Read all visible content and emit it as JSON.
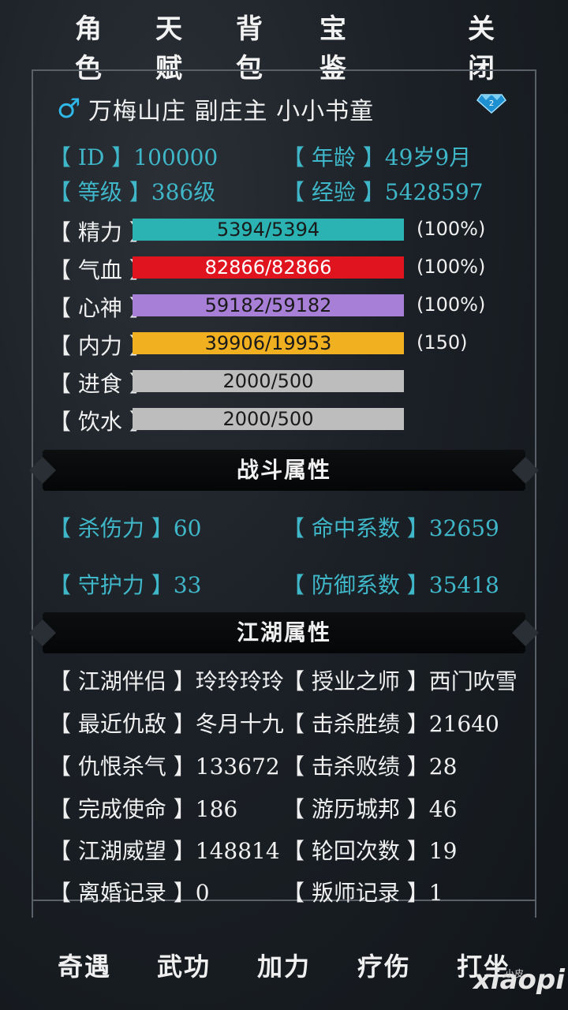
{
  "nav": {
    "tabs": [
      "角色",
      "天赋",
      "背包",
      "宝鉴"
    ],
    "close": "关闭"
  },
  "header": {
    "gender_icon": "male-icon",
    "name": "万梅山庄  副庄主  小小书童",
    "badge_icon": "vip-diamond-icon",
    "badge_color": "#2fb8e8"
  },
  "info": {
    "id": "【  ID  】100000",
    "age": "【 年龄 】49岁9月",
    "level": "【 等级 】386级",
    "exp": "【 经验 】5428597"
  },
  "stats": [
    {
      "label": "【 精力 】",
      "text": "5394/5394",
      "pct": "(100%)",
      "fill": 1.0,
      "color": "#2bb3b3"
    },
    {
      "label": "【 气血 】",
      "text": "82866/82866",
      "pct": "(100%)",
      "fill": 1.0,
      "color": "#e0141e"
    },
    {
      "label": "【 心神 】",
      "text": "59182/59182",
      "pct": "(100%)",
      "fill": 1.0,
      "color": "#a87fd6"
    },
    {
      "label": "【 内力 】",
      "text": "39906/19953",
      "pct": "(150)",
      "fill": 1.0,
      "color": "#f0b020"
    },
    {
      "label": "【 进食 】",
      "text": "2000/500",
      "pct": "",
      "fill": 1.0,
      "color": "#bdbdbd"
    },
    {
      "label": "【 饮水 】",
      "text": "2000/500",
      "pct": "",
      "fill": 1.0,
      "color": "#bdbdbd"
    }
  ],
  "battle": {
    "title": "战斗属性",
    "kill": "【 杀伤力 】60",
    "hit": "【 命中系数 】32659",
    "guard": "【 守护力 】33",
    "defense": "【 防御系数 】35418"
  },
  "jianghu": {
    "title": "江湖属性",
    "rows": [
      [
        "【 江湖伴侣 】玲玲玲玲",
        "【 授业之师 】西门吹雪"
      ],
      [
        "【 最近仇敌 】冬月十九",
        "【 击杀胜绩 】21640"
      ],
      [
        "【 仇恨杀气 】133672",
        "【 击杀败绩 】28"
      ],
      [
        "【 完成使命 】186",
        "【 游历城邦 】46"
      ],
      [
        "【 江湖威望 】148814",
        "【 轮回次数 】19"
      ],
      [
        "【 离婚记录 】0",
        "【 叛师记录 】1"
      ]
    ]
  },
  "bottom": [
    "奇遇",
    "武功",
    "加力",
    "疗伤",
    "打坐"
  ],
  "watermark": "xiaopi",
  "watermark_small": "小皮"
}
